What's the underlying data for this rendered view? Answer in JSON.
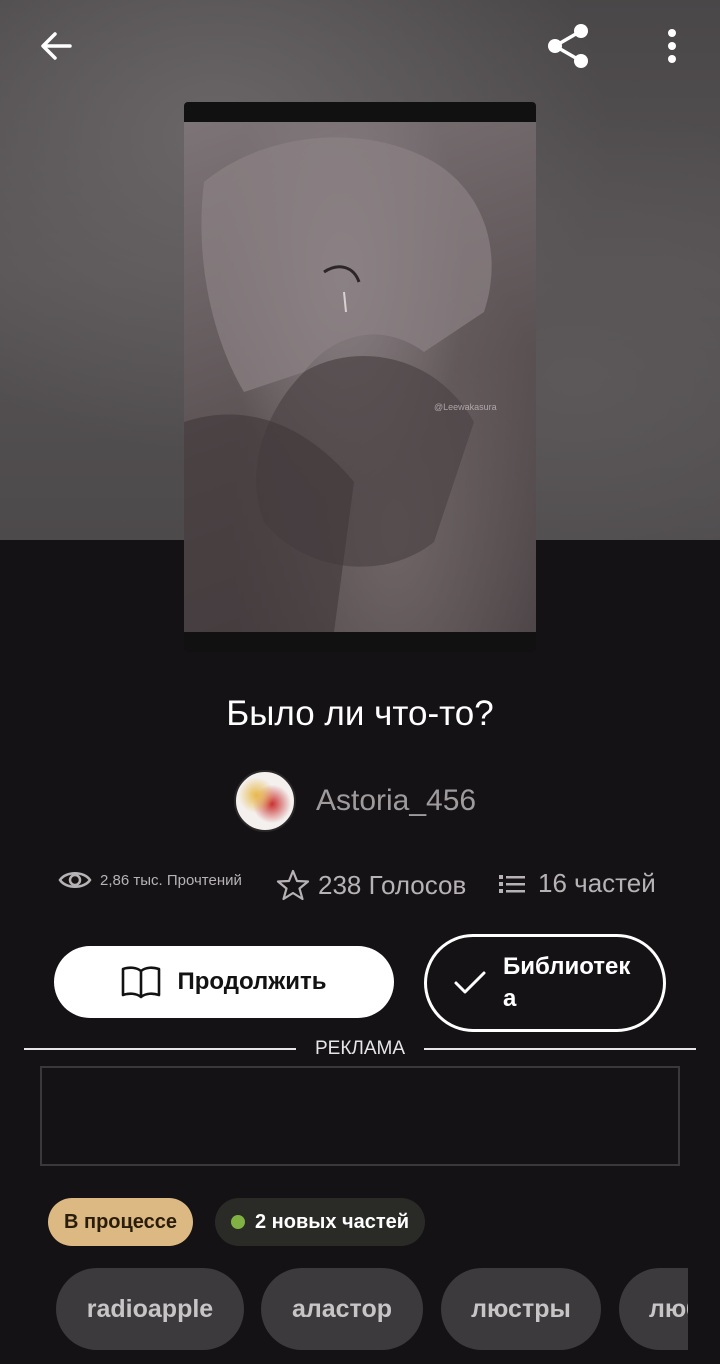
{
  "toolbar": {
    "back_icon": "arrow-left-icon",
    "share_icon": "share-icon",
    "more_icon": "more-vertical-icon"
  },
  "story": {
    "cover_watermark": "@Leewakasura",
    "title": "Было ли что-то?",
    "author": "Astoria_456"
  },
  "stats": {
    "reads": "2,86 тыс. Прочтений",
    "votes": "238 Голосов",
    "parts": "16 частей"
  },
  "actions": {
    "continue_label": "Продолжить",
    "library_label": "Библиотека"
  },
  "ad": {
    "label": "РЕКЛАМА"
  },
  "badges": {
    "status": "В процессе",
    "new_parts": "2 новых частей"
  },
  "tags": [
    "radioapple",
    "аластор",
    "люстры",
    "люб"
  ],
  "colors": {
    "background": "#141215",
    "status_badge": "#dcb982",
    "new_dot": "#7fb242",
    "tag_bg": "#3c3a3c"
  }
}
